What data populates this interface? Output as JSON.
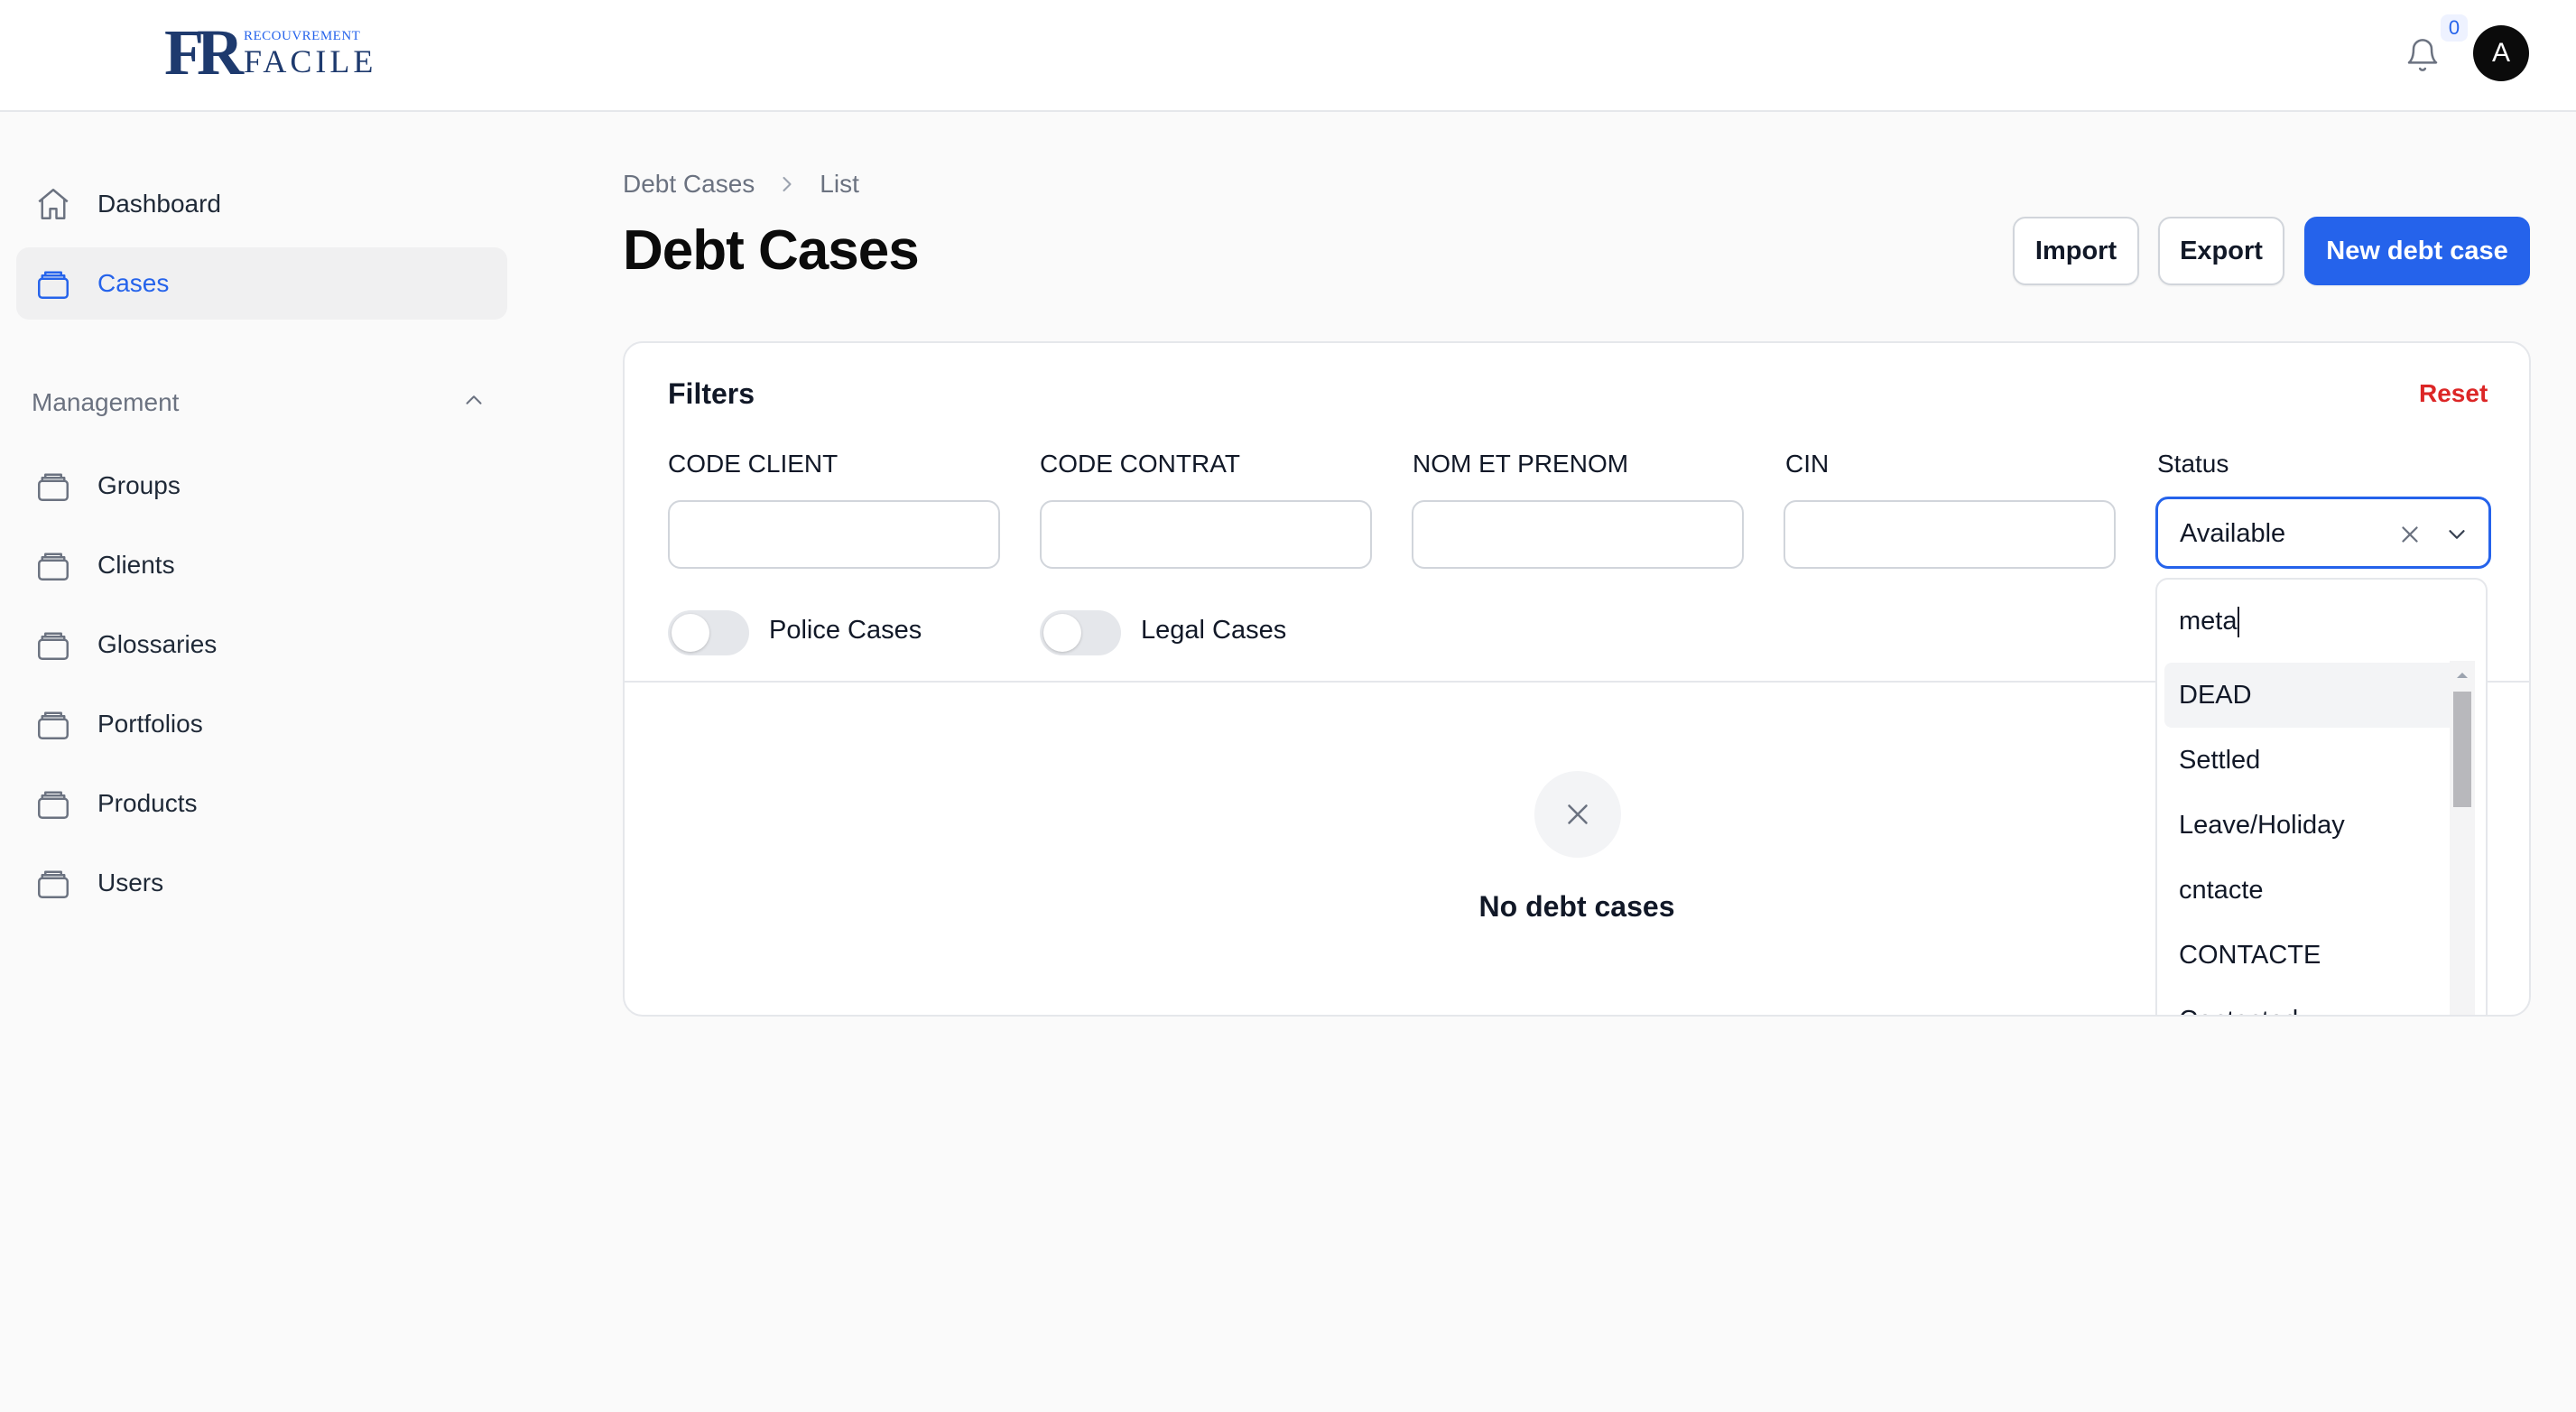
{
  "brand": {
    "mark": "FR",
    "small_text": "RECOUVREMENT",
    "big_text": "FACILE"
  },
  "header": {
    "notification_count": "0",
    "avatar_initial": "A"
  },
  "sidebar": {
    "items": [
      {
        "label": "Dashboard",
        "icon": "home-icon"
      },
      {
        "label": "Cases",
        "icon": "folder-icon",
        "active": true
      }
    ],
    "group": {
      "label": "Management",
      "expanded": true,
      "items": [
        {
          "label": "Groups",
          "icon": "folder-icon"
        },
        {
          "label": "Clients",
          "icon": "folder-icon"
        },
        {
          "label": "Glossaries",
          "icon": "folder-icon"
        },
        {
          "label": "Portfolios",
          "icon": "folder-icon"
        },
        {
          "label": "Products",
          "icon": "folder-icon"
        },
        {
          "label": "Users",
          "icon": "folder-icon"
        }
      ]
    }
  },
  "breadcrumb": {
    "items": [
      "Debt Cases",
      "List"
    ]
  },
  "page": {
    "title": "Debt Cases"
  },
  "actions": {
    "import": "Import",
    "export": "Export",
    "new": "New debt case"
  },
  "filters": {
    "title": "Filters",
    "reset": "Reset",
    "fields": [
      {
        "label": "CODE CLIENT",
        "value": ""
      },
      {
        "label": "CODE CONTRAT",
        "value": ""
      },
      {
        "label": "NOM ET PRENOM",
        "value": ""
      },
      {
        "label": "CIN",
        "value": ""
      }
    ],
    "status": {
      "label": "Status",
      "value": "Available"
    },
    "toggles": [
      {
        "label": "Police Cases",
        "on": false
      },
      {
        "label": "Legal Cases",
        "on": false
      }
    ]
  },
  "empty_state": {
    "text": "No debt cases"
  },
  "status_dropdown": {
    "search": "meta",
    "options": [
      "DEAD",
      "Settled",
      "Leave/Holiday",
      "cntacte",
      "CONTACTE",
      "Contacted"
    ],
    "highlighted": "DEAD"
  },
  "colors": {
    "accent": "#2563eb",
    "danger": "#dc2626",
    "background": "#fafafa"
  }
}
